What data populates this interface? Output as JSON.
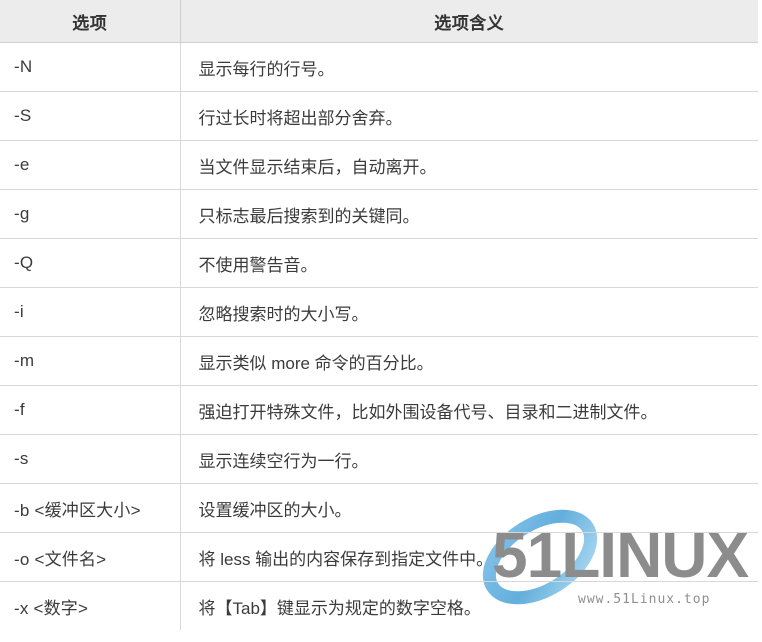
{
  "table": {
    "headers": {
      "option": "选项",
      "meaning": "选项含义"
    },
    "rows": [
      {
        "option": "-N",
        "meaning": "显示每行的行号。"
      },
      {
        "option": "-S",
        "meaning": "行过长时将超出部分舍弃。"
      },
      {
        "option": "-e",
        "meaning": "当文件显示结束后，自动离开。"
      },
      {
        "option": "-g",
        "meaning": "只标志最后搜索到的关键同。"
      },
      {
        "option": "-Q",
        "meaning": "不使用警告音。"
      },
      {
        "option": "-i",
        "meaning": "忽略搜索时的大小写。"
      },
      {
        "option": "-m",
        "meaning": "显示类似 more 命令的百分比。"
      },
      {
        "option": "-f",
        "meaning": "强迫打开特殊文件，比如外围设备代号、目录和二进制文件。"
      },
      {
        "option": "-s",
        "meaning": "显示连续空行为一行。"
      },
      {
        "option": "-b <缓冲区大小>",
        "meaning": "设置缓冲区的大小。"
      },
      {
        "option": "-o <文件名>",
        "meaning": "将 less 输出的内容保存到指定文件中。"
      },
      {
        "option": "-x <数字>",
        "meaning": "将【Tab】键显示为规定的数字空格。"
      }
    ]
  },
  "watermark": {
    "brand": "51LINUX",
    "url": "www.51Linux.top",
    "brand_color": "#8a8a8a",
    "swoosh_color": "#6cb3e0",
    "url_color": "#8a8a8a"
  },
  "colors": {
    "header_bg": "#ececec",
    "header_text": "#333333",
    "body_text": "#3b3b3b",
    "border": "#d8d8d8",
    "page_bg": "#ffffff"
  }
}
